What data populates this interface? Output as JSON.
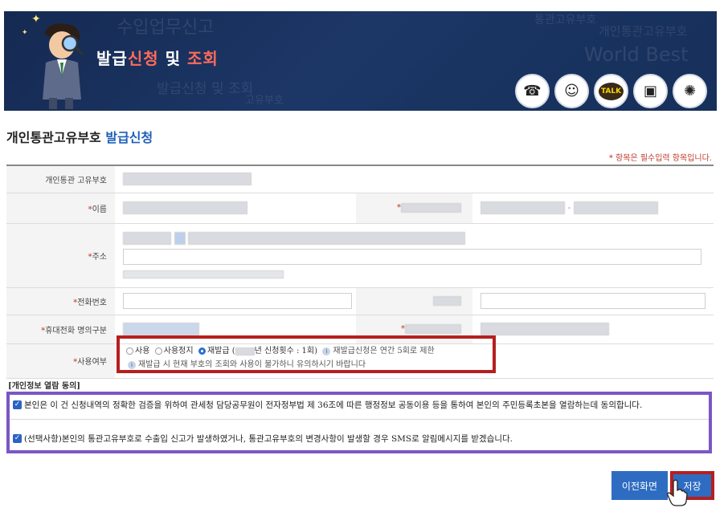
{
  "banner": {
    "title_part1": "발급",
    "title_part2": "신청",
    "title_part3": " 및 ",
    "title_part4": "조회",
    "bg_words": [
      "수입업무신고",
      "World Best",
      "개인통관고유부호",
      "통관고유부호",
      "발급신청 및 조회",
      "고유부호"
    ],
    "icons": [
      "phone-icon",
      "robot-icon",
      "talk-icon",
      "presentation-icon",
      "customs-emblem-icon"
    ],
    "talk_label": "TALK"
  },
  "page": {
    "heading_part1": "개인통관고유부호",
    "heading_part2": "발급신청",
    "required_note": "* 항목은 필수입력 항목입니다."
  },
  "form": {
    "code_label": "개인통관 고유부호",
    "name_label": "이름",
    "address_label": "주소",
    "phone_label": "전화번호",
    "mobile_owner_label": "휴대전화 명의구분",
    "usage_label": "사용여부",
    "usage_options": [
      "사용",
      "사용정지",
      "재발급"
    ],
    "usage_selected": "재발급",
    "reissue_detail": "(",
    "reissue_detail2": "년 신청횟수 : 1회)",
    "reissue_note1": "재발급신청은 연간 5회로 제한",
    "reissue_note2": "재발급 시 현재 부호의 조회와 사용이 불가하니 유의하시기 바랍니다"
  },
  "consent": {
    "title": "[개인정보 열람 동의]",
    "item1": "본인은 이 건 신청내역의 정확한 검증을 위하여 관세청 담당공무원이 전자정부법 제 36조에 따른 행정정보 공동이용 등을 통하여 본인의 주민등록초본을 열람하는데 동의합니다.",
    "item2": "(선택사항)본인의 통관고유부호로 수출입 신고가 발생하였거나, 통관고유부호의 변경사항이 발생할 경우 SMS로 알림메시지를 받겠습니다."
  },
  "buttons": {
    "prev": "이전화면",
    "save": "저장"
  },
  "colors": {
    "banner_bg": "#1c3666",
    "accent_red": "#ff6b5a",
    "heading_blue": "#1f5fb8",
    "highlight_red": "#b51f1f",
    "highlight_purple": "#7b57c3",
    "button_blue": "#2e6cc2"
  }
}
